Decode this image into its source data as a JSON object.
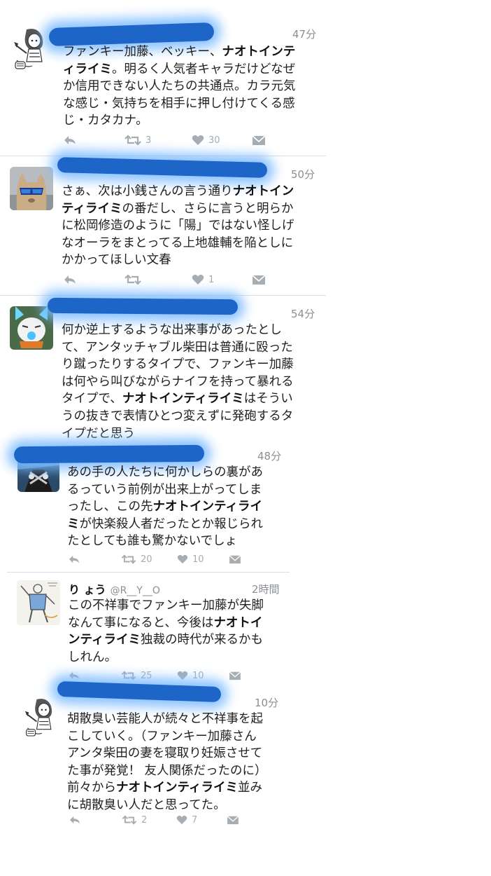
{
  "tweets": [
    {
      "time": "47分",
      "avatar": "manga-girl-avatar",
      "text": [
        {
          "t": "ファンキー加藤、ベッキー、"
        },
        {
          "b": "ナオトインテ"
        },
        {
          "t": "\n"
        },
        {
          "b": "ィライミ"
        },
        {
          "t": "。明るく人気者キャラだけどなぜ\nか信用できない人たちの共通点。カラ元気\nな感じ・気持ちを相手に押し付けてくる感\nじ・カタカナ。"
        }
      ],
      "retweets": "3",
      "likes": "30"
    },
    {
      "time": "50分",
      "avatar": "cat-sunglasses-avatar",
      "text": [
        {
          "t": "さぁ、次は小銭さんの言う通り"
        },
        {
          "b": "ナオトイン"
        },
        {
          "t": "\n"
        },
        {
          "b": "ティライミ"
        },
        {
          "t": "の番だし、さらに言うと明らか\nに松岡修造のように「陽」ではない怪しげ\nなオーラをまとってる上地雄輔を陥としに\nかかってほしい文春"
        }
      ],
      "retweets": "",
      "likes": "1"
    },
    {
      "time": "54分",
      "avatar": "yokai-cat-avatar",
      "text": [
        {
          "t": "何か逆上するような出来事があったとし\nて、アンタッチャブル柴田は普通に殴った\nり蹴ったりするタイプで、ファンキー加藤\nは何やら叫びながらナイフを持って暴れる\nタイプで、"
        },
        {
          "b": "ナオトインティライミ"
        },
        {
          "t": "はそうい\nうの抜きで表情ひとつ変えずに発砲するタ\nイプだと思う"
        }
      ],
      "retweets": "",
      "likes": ""
    },
    {
      "time": "48分",
      "avatar": "dark-character-avatar",
      "text": [
        {
          "t": "あの手の人たちに何かしらの裏があ\nるっていう前例が出来上がってしま\nったし、この先"
        },
        {
          "b": "ナオトインティライ"
        },
        {
          "t": "\n"
        },
        {
          "b": "ミ"
        },
        {
          "t": "が快楽殺人者だったとか報じられ\nたとしても誰も驚かないでしょ"
        }
      ],
      "retweets": "20",
      "likes": "10"
    },
    {
      "time": "2時間",
      "avatar": "sketch-man-avatar",
      "display_name": "り ょう",
      "screen_name": "@R__Y__O",
      "text": [
        {
          "t": "この不祥事でファンキー加藤が失脚\nなんて事になると、今後は"
        },
        {
          "b": "ナオトイ"
        },
        {
          "t": "\n"
        },
        {
          "b": "ンティライミ"
        },
        {
          "t": "独裁の時代が来るかも\nしれん。"
        }
      ],
      "retweets": "25",
      "likes": "10"
    },
    {
      "time": "10分",
      "avatar": "manga-girl-avatar",
      "text": [
        {
          "t": "胡散臭い芸能人が続々と不祥事を起\nこしていく。（ファンキー加藤さん\nアンタ柴田の妻を寝取り妊娠させて\nた事が発覚！ 友人関係だったのに）\n前々から"
        },
        {
          "b": "ナオトインティライミ"
        },
        {
          "t": "並み\nに胡散臭い人だと思ってた。"
        }
      ],
      "retweets": "2",
      "likes": "7"
    }
  ],
  "colors": {
    "redaction": "#1d66c8",
    "redaction_glow": "#78b9ff",
    "meta_gray": "#8a8f94",
    "icon_gray": "#a6adb3",
    "divider": "#dcdfe2"
  }
}
